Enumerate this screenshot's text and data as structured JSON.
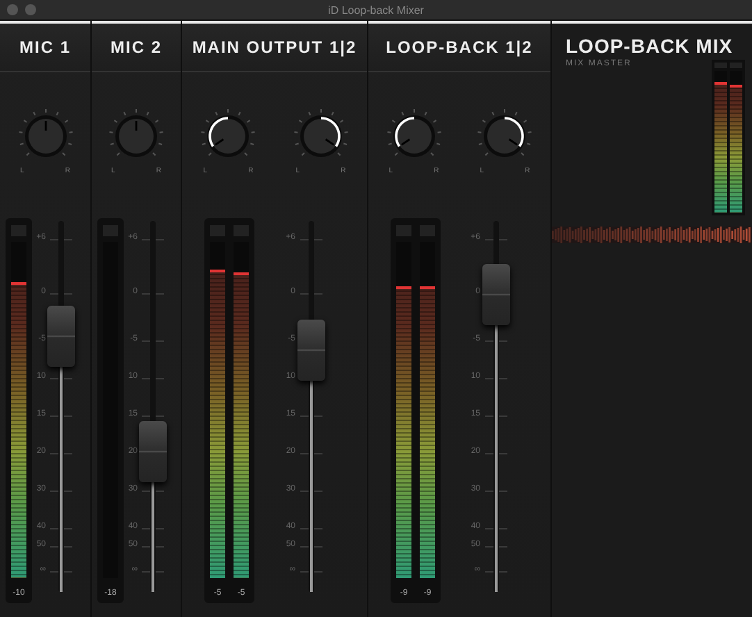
{
  "window": {
    "title": "iD Loop-back Mixer"
  },
  "channels": [
    {
      "name": "MIC 1",
      "knobs": [
        {
          "pan_left": false,
          "pan_right": false,
          "left": "L",
          "right": "R"
        }
      ],
      "meters": [
        {
          "level": 0.87,
          "reading": "-10"
        }
      ],
      "fader": {
        "level": 0.69
      },
      "scale": [
        "+6",
        "0",
        "-5",
        "10",
        "15",
        "20",
        "30",
        "40",
        "50",
        "∞"
      ]
    },
    {
      "name": "MIC 2",
      "knobs": [
        {
          "pan_left": false,
          "pan_right": false,
          "left": "L",
          "right": "R"
        }
      ],
      "meters": [
        {
          "reading": "-18"
        }
      ],
      "fader": {
        "level": 0.38
      },
      "scale": [
        "+6",
        "0",
        "-5",
        "10",
        "15",
        "20",
        "30",
        "40",
        "50",
        "∞"
      ]
    },
    {
      "name": "MAIN OUTPUT 1|2",
      "knobs": [
        {
          "pan_left": true,
          "pan_right": false,
          "left": "L",
          "right": "R"
        },
        {
          "pan_left": false,
          "pan_right": true,
          "left": "L",
          "right": "R"
        }
      ],
      "meters": [
        {
          "level": 0.91,
          "reading": "-5"
        },
        {
          "level": 0.9,
          "reading": "-5"
        }
      ],
      "fader": {
        "level": 0.65
      },
      "scale": [
        "+6",
        "0",
        "-5",
        "10",
        "15",
        "20",
        "30",
        "40",
        "50",
        "∞"
      ]
    },
    {
      "name": "LOOP-BACK 1|2",
      "knobs": [
        {
          "pan_left": true,
          "pan_right": false,
          "left": "L",
          "right": "R"
        },
        {
          "pan_left": false,
          "pan_right": true,
          "left": "L",
          "right": "R"
        }
      ],
      "meters": [
        {
          "level": 0.86,
          "reading": "-9"
        },
        {
          "level": 0.86,
          "reading": "-9"
        }
      ],
      "fader": {
        "level": 0.8
      },
      "scale": [
        "+6",
        "0",
        "-5",
        "10",
        "15",
        "20",
        "30",
        "40",
        "50",
        "∞"
      ]
    }
  ],
  "master": {
    "title": "LOOP-BACK MIX",
    "subtitle": "MIX MASTER",
    "meters": [
      {
        "level": 0.9
      },
      {
        "level": 0.88
      }
    ]
  }
}
